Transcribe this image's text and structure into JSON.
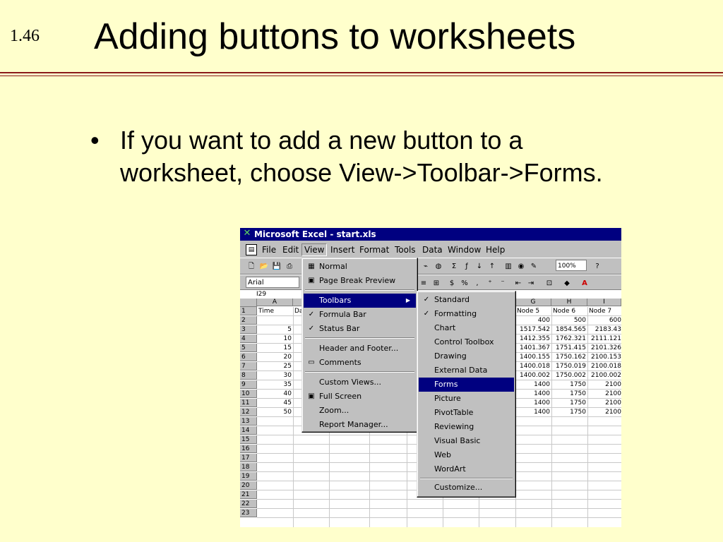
{
  "slide": {
    "number": "1.46",
    "title": "Adding buttons to worksheets",
    "bullet": "If you want to add a new button to a worksheet, choose View->Toolbar->Forms."
  },
  "window": {
    "title": "Microsoft Excel - start.xls",
    "menus": [
      "File",
      "Edit",
      "View",
      "Insert",
      "Format",
      "Tools",
      "Data",
      "Window",
      "Help"
    ],
    "font_name": "Arial",
    "zoom": "100%",
    "name_box": "I29"
  },
  "grid": {
    "columns": [
      "A",
      "G",
      "H",
      "I"
    ],
    "row_numbers": [
      "1",
      "2",
      "3",
      "4",
      "5",
      "6",
      "7",
      "8",
      "9",
      "10",
      "11",
      "12",
      "13",
      "14",
      "15",
      "16",
      "17",
      "18",
      "19",
      "20",
      "21",
      "22",
      "23"
    ],
    "col_a": [
      "Time",
      "",
      "5",
      "10",
      "15",
      "20",
      "25",
      "30",
      "35",
      "40",
      "45",
      "50"
    ],
    "col_b_row1": "Da",
    "col_g": [
      "Node 5",
      "400",
      "1517.542",
      "1412.355",
      "1401.367",
      "1400.155",
      "1400.018",
      "1400.002",
      "1400",
      "1400",
      "1400",
      "1400"
    ],
    "col_h": [
      "Node 6",
      "500",
      "1854.565",
      "1762.321",
      "1751.415",
      "1750.162",
      "1750.019",
      "1750.002",
      "1750",
      "1750",
      "1750",
      "1750"
    ],
    "col_i": [
      "Node 7",
      "600",
      "2183.43",
      "2111.121",
      "2101.326",
      "2100.153",
      "2100.018",
      "2100.002",
      "2100",
      "2100",
      "2100",
      "2100"
    ]
  },
  "view_menu": {
    "items": [
      {
        "label": "Normal",
        "icon": "normal-view-icon"
      },
      {
        "label": "Page Break Preview",
        "icon": "page-break-icon"
      },
      {
        "label": "Toolbars",
        "icon": "",
        "submenu": true,
        "selected": true
      },
      {
        "label": "Formula Bar",
        "icon": "check-icon"
      },
      {
        "label": "Status Bar",
        "icon": "check-icon"
      },
      {
        "label": "Header and Footer...",
        "icon": ""
      },
      {
        "label": "Comments",
        "icon": "comments-icon"
      },
      {
        "label": "Custom Views...",
        "icon": ""
      },
      {
        "label": "Full Screen",
        "icon": "full-screen-icon"
      },
      {
        "label": "Zoom...",
        "icon": ""
      },
      {
        "label": "Report Manager...",
        "icon": ""
      }
    ]
  },
  "toolbars_menu": {
    "items": [
      {
        "label": "Standard",
        "checked": true
      },
      {
        "label": "Formatting",
        "checked": true
      },
      {
        "label": "Chart",
        "checked": false
      },
      {
        "label": "Control Toolbox",
        "checked": false
      },
      {
        "label": "Drawing",
        "checked": false
      },
      {
        "label": "External Data",
        "checked": false
      },
      {
        "label": "Forms",
        "checked": false,
        "selected": true
      },
      {
        "label": "Picture",
        "checked": false
      },
      {
        "label": "PivotTable",
        "checked": false
      },
      {
        "label": "Reviewing",
        "checked": false
      },
      {
        "label": "Visual Basic",
        "checked": false
      },
      {
        "label": "Web",
        "checked": false
      },
      {
        "label": "WordArt",
        "checked": false
      },
      {
        "label": "Customize...",
        "checked": false
      }
    ]
  },
  "colors": {
    "slide_bg": "#ffffcc",
    "rule": "#8b1a1a",
    "titlebar": "#000080",
    "highlight": "#000080"
  }
}
